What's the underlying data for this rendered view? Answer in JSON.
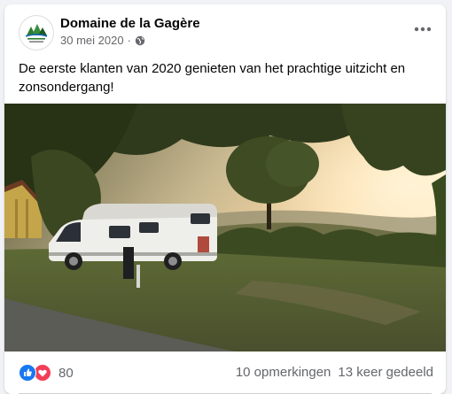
{
  "post": {
    "page_name": "Domaine de la Gagère",
    "date": "30 mei 2020",
    "dot": "·",
    "avatar_logo_text": [
      "Domaine",
      "de la Gagère"
    ],
    "text": "De eerste klanten van 2020 genieten van het prachtige uitzicht en zonsondergang!"
  },
  "footer": {
    "reaction_count": "80",
    "comments": "10 opmerkingen",
    "shares": "13 keer gedeeld"
  },
  "icons": {
    "audience": "globe-icon",
    "menu": "more-options-icon",
    "reactions": [
      "like-icon",
      "love-icon"
    ]
  },
  "colors": {
    "like": "#1877f2",
    "love": "#f33e58",
    "text_secondary": "#65676b"
  }
}
